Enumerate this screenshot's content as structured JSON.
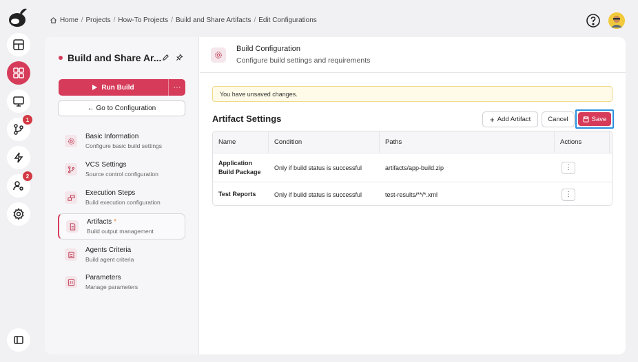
{
  "breadcrumb": {
    "items": [
      "Home",
      "Projects",
      "How-To Projects",
      "Build and Share Artifacts",
      "Edit Configurations"
    ]
  },
  "rail": {
    "vcs_badge": "1",
    "users_badge": "2"
  },
  "sidebar": {
    "project_title": "Build and Share Ar...",
    "run_label": "Run Build",
    "more_label": "···",
    "goto_label": "← Go to Configuration",
    "items": [
      {
        "title": "Basic Information",
        "subtitle": "Configure basic build settings"
      },
      {
        "title": "VCS Settings",
        "subtitle": "Source control configuration"
      },
      {
        "title": "Execution Steps",
        "subtitle": "Build execution configuration"
      },
      {
        "title": "Artifacts",
        "subtitle": "Build output management",
        "modified": "*"
      },
      {
        "title": "Agents Criteria",
        "subtitle": "Build agent criteria"
      },
      {
        "title": "Parameters",
        "subtitle": "Manage parameters"
      }
    ]
  },
  "content": {
    "title": "Build Configuration",
    "subtitle": "Configure build settings and requirements",
    "warning": "You have unsaved changes.",
    "section_title": "Artifact Settings",
    "add_label": "Add Artifact",
    "cancel_label": "Cancel",
    "save_label": "Save"
  },
  "table": {
    "headers": [
      "Name",
      "Condition",
      "Paths",
      "Actions"
    ],
    "rows": [
      {
        "name": "Application Build Package",
        "condition": "Only if build status is successful",
        "paths": "artifacts/app-build.zip"
      },
      {
        "name": "Test Reports",
        "condition": "Only if build status is successful",
        "paths": "test-results/**/*.xml"
      }
    ],
    "action_label": "⋮"
  },
  "colors": {
    "accent": "#d63c5a",
    "focus": "#2a8fde",
    "warning_bg": "#fffbe8"
  }
}
